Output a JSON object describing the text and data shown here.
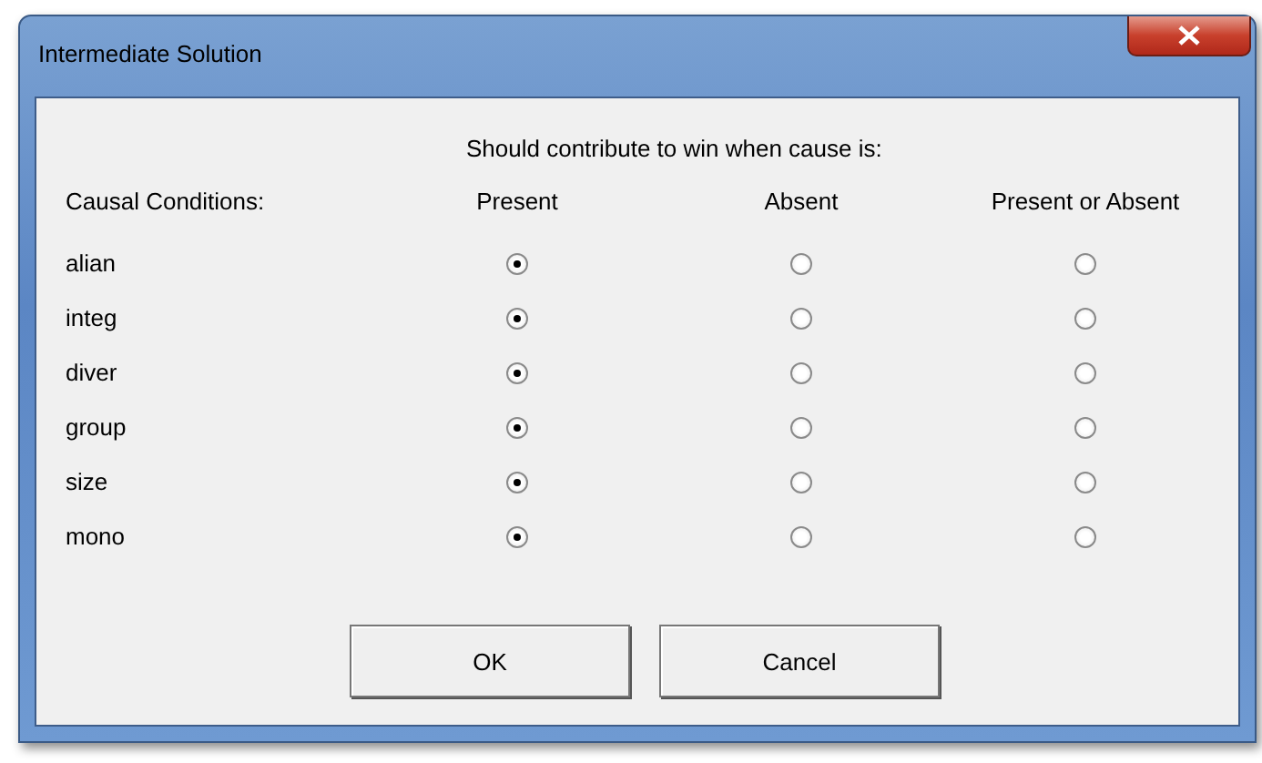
{
  "window": {
    "title": "Intermediate Solution"
  },
  "prompt": "Should contribute to win when cause is:",
  "columns": [
    "Causal Conditions:",
    "Present",
    "Absent",
    "Present or Absent"
  ],
  "rows": [
    {
      "label": "alian",
      "options": [
        {
          "selected": true
        },
        {
          "selected": false
        },
        {
          "selected": false
        }
      ]
    },
    {
      "label": "integ",
      "options": [
        {
          "selected": true
        },
        {
          "selected": false
        },
        {
          "selected": false
        }
      ]
    },
    {
      "label": "diver",
      "options": [
        {
          "selected": true
        },
        {
          "selected": false
        },
        {
          "selected": false
        }
      ]
    },
    {
      "label": "group",
      "options": [
        {
          "selected": true
        },
        {
          "selected": false
        },
        {
          "selected": false
        }
      ]
    },
    {
      "label": "size",
      "options": [
        {
          "selected": true
        },
        {
          "selected": false
        },
        {
          "selected": false
        }
      ]
    },
    {
      "label": "mono",
      "options": [
        {
          "selected": true
        },
        {
          "selected": false
        },
        {
          "selected": false
        }
      ]
    }
  ],
  "buttons": [
    "OK",
    "Cancel"
  ]
}
